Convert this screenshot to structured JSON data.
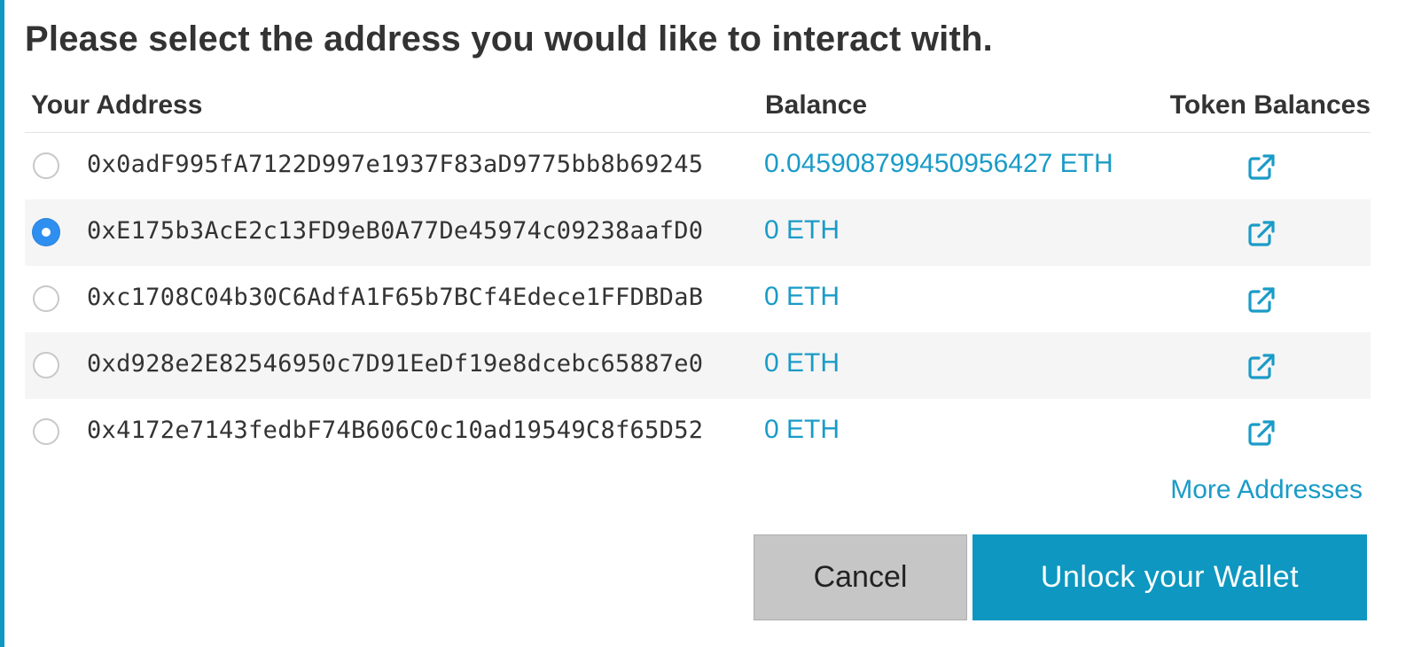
{
  "title": "Please select the address you would like to interact with.",
  "columns": {
    "address": "Your Address",
    "balance": "Balance",
    "tokens": "Token Balances"
  },
  "rows": [
    {
      "address": "0x0adF995fA7122D997e1937F83aD9775bb8b69245",
      "balance": "0.045908799450956427 ETH",
      "selected": false
    },
    {
      "address": "0xE175b3AcE2c13FD9eB0A77De45974c09238aafD0",
      "balance": "0 ETH",
      "selected": true
    },
    {
      "address": "0xc1708C04b30C6AdfA1F65b7BCf4Edece1FFDBDaB",
      "balance": "0 ETH",
      "selected": false
    },
    {
      "address": "0xd928e2E82546950c7D91EeDf19e8dcebc65887e0",
      "balance": "0 ETH",
      "selected": false
    },
    {
      "address": "0x4172e7143fedbF74B606C0c10ad19549C8f65D52",
      "balance": "0 ETH",
      "selected": false
    }
  ],
  "more_addresses": "More Addresses",
  "buttons": {
    "cancel": "Cancel",
    "unlock": "Unlock your Wallet"
  },
  "icons": {
    "token_link": "external-link-icon",
    "selection": "radio-button"
  },
  "colors": {
    "accent": "#0e97c0",
    "link": "#1a9bc7",
    "radio_selected": "#2f8ff0",
    "row_alt": "#f5f5f5",
    "cancel_bg": "#c6c6c6"
  }
}
